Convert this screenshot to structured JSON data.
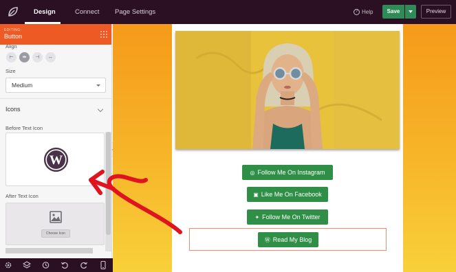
{
  "topbar": {
    "tabs": [
      {
        "label": "Design",
        "active": true
      },
      {
        "label": "Connect",
        "active": false
      },
      {
        "label": "Page Settings",
        "active": false
      }
    ],
    "help_label": "Help",
    "save_label": "Save",
    "preview_label": "Preview"
  },
  "panel": {
    "editing_label": "EDITING:",
    "editing_title": "Button",
    "align_label": "Align",
    "align_options": [
      "align-left-icon",
      "align-center-icon",
      "align-right-icon",
      "align-full-icon"
    ],
    "align_selected": "center",
    "size_label": "Size",
    "size_value": "Medium",
    "icons_section": "Icons",
    "before_icon_label": "Before Text Icon",
    "before_icon": "wordpress-icon",
    "after_icon_label": "After Text Icon",
    "choose_icon_label": "Choose Icon"
  },
  "bottombar": {
    "icons": [
      "settings-icon",
      "layers-icon",
      "history-icon",
      "undo-icon",
      "redo-icon",
      "mobile-preview-icon"
    ]
  },
  "canvas": {
    "buttons": [
      {
        "label": "Follow Me On Instagram",
        "icon": "instagram-icon"
      },
      {
        "label": "Like Me On Facebook",
        "icon": "facebook-icon"
      },
      {
        "label": "Follow Me On Twitter",
        "icon": "twitter-icon"
      },
      {
        "label": "Read My Blog",
        "icon": "wordpress-icon"
      }
    ]
  },
  "colors": {
    "topbar": "#2b0f23",
    "accent": "#ee5a24",
    "save_green": "#2e8b57",
    "button_green": "#2f8f46",
    "annotation_red": "#e0141e"
  }
}
